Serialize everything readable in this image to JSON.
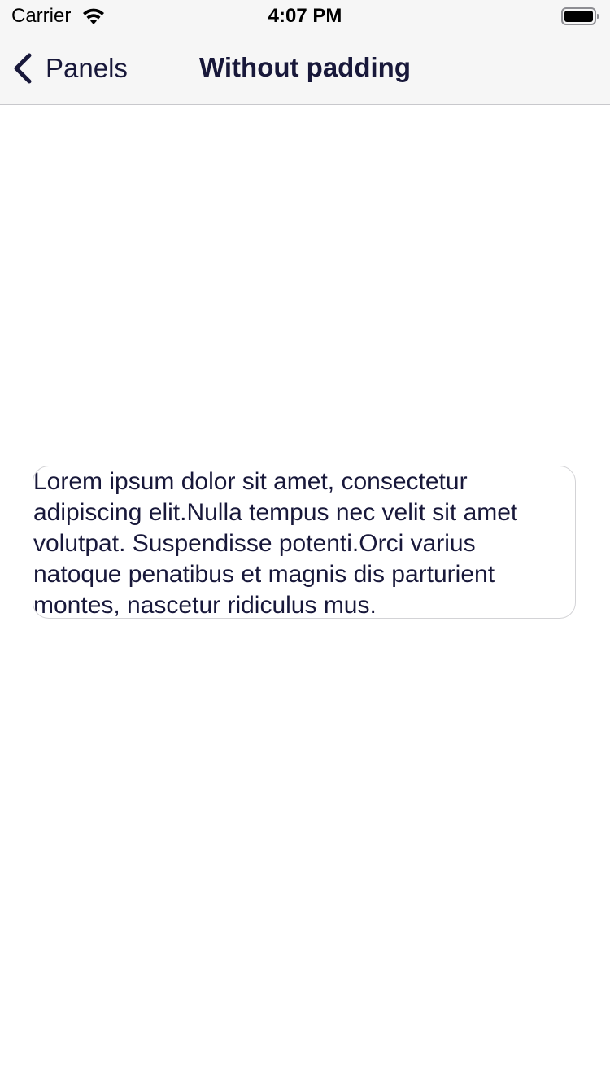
{
  "status_bar": {
    "carrier": "Carrier",
    "time": "4:07 PM",
    "wifi_icon": "wifi-icon",
    "battery_icon": "battery-icon"
  },
  "nav": {
    "back_label": "Panels",
    "back_icon": "chevron-left-icon",
    "title": "Without padding"
  },
  "panel": {
    "text": "Lorem ipsum dolor sit amet, consectetur\nadipiscing elit.Nulla tempus nec velit sit amet\nvolutpat. Suspendisse potenti.Orci varius\nnatoque penatibus et magnis dis parturient\nmontes, nascetur ridiculus mus."
  },
  "colors": {
    "text": "#18183a",
    "nav_background": "#f6f6f6",
    "panel_border": "#d3d3d6"
  }
}
